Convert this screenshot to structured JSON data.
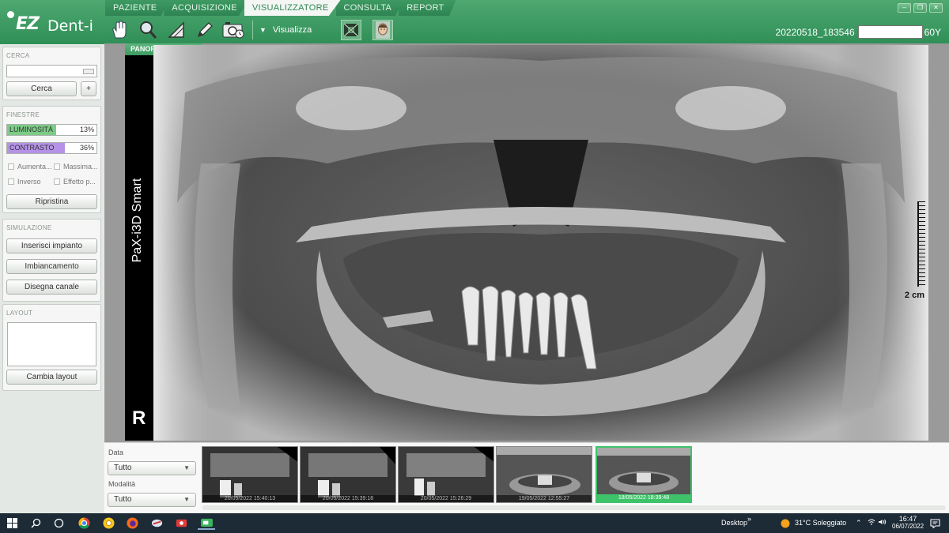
{
  "app": {
    "logo_ez": "EZ",
    "logo_dent": "Dent-i"
  },
  "tabs": [
    {
      "label": "PAZIENTE"
    },
    {
      "label": "ACQUISIZIONE"
    },
    {
      "label": "VISUALIZZATORE"
    },
    {
      "label": "CONSULTA"
    },
    {
      "label": "REPORT"
    }
  ],
  "active_tab": "VISUALIZZATORE",
  "toolbar": {
    "visualizza_label": "Visualizza"
  },
  "patient": {
    "id": "20220518_183546",
    "age": "60Y"
  },
  "search": {
    "section": "CERCA",
    "button": "Cerca",
    "add": "+"
  },
  "windows": {
    "section": "FINESTRE",
    "luminosita": {
      "label": "LUMINOSITÀ",
      "value": "13%",
      "level": 0.55,
      "color": "#7ccb86"
    },
    "contrasto": {
      "label": "CONTRASTO",
      "value": "36%",
      "level": 0.65,
      "color": "#b592e8"
    },
    "checks": [
      "Aumenta...",
      "Massima...",
      "Inverso",
      "Effetto p..."
    ],
    "reset": "Ripristina"
  },
  "simulation": {
    "section": "SIMULAZIONE",
    "buttons": [
      "Inserisci impianto",
      "Imbiancamento",
      "Disegna canale"
    ]
  },
  "layout": {
    "section": "LAYOUT",
    "button": "Cambia layout"
  },
  "viewer": {
    "image_type": "PANORAMICA",
    "device": "PaX-i3D Smart",
    "side": "R",
    "scale": "2 cm"
  },
  "filters": {
    "data_label": "Data",
    "data_value": "Tutto",
    "modalita_label": "Modalità",
    "modalita_value": "Tutto"
  },
  "thumbnails": [
    {
      "date": "20/05/2022 15:40:13"
    },
    {
      "date": "20/05/2022 15:39:18"
    },
    {
      "date": "20/05/2022 15:26:29"
    },
    {
      "date": "19/05/2022 12:55:27"
    },
    {
      "date": "18/05/2022 18:39:48"
    }
  ],
  "taskbar": {
    "desktop": "Desktop",
    "weather": "31°C  Soleggiato",
    "time": "16:47",
    "date": "06/07/2022"
  }
}
